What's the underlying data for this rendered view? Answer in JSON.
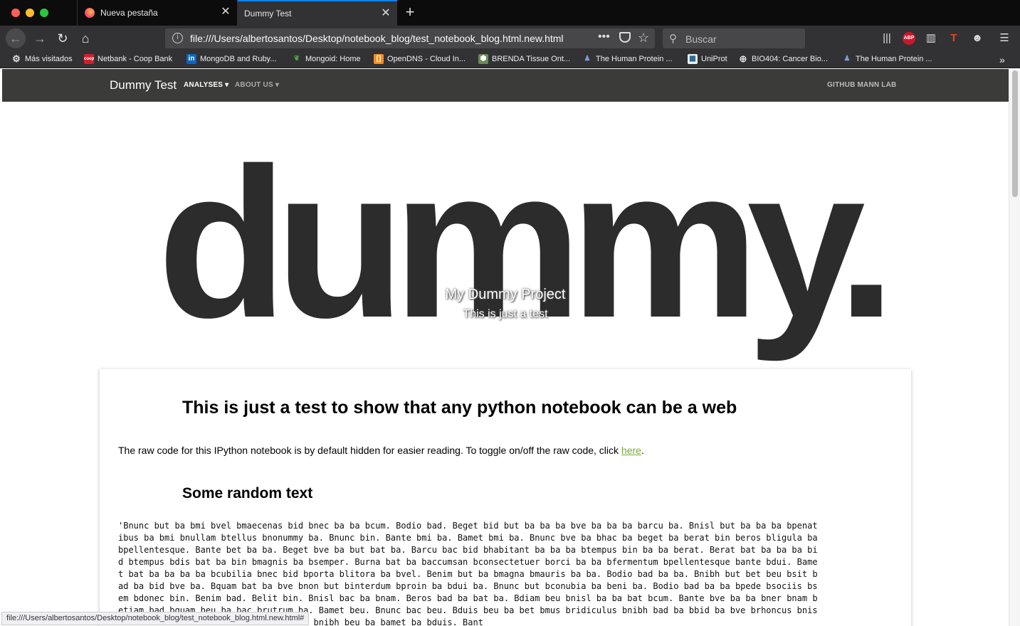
{
  "tabs": [
    {
      "label": "Nueva pestaña"
    },
    {
      "label": "Dummy Test"
    }
  ],
  "toolbar": {
    "url": "file:///Users/albertosantos/Desktop/notebook_blog/test_notebook_blog.html.new.html",
    "search_placeholder": "Buscar"
  },
  "bookmarks": [
    {
      "label": "Más visitados"
    },
    {
      "label": "Netbank - Coop Bank"
    },
    {
      "label": "MongoDB and Ruby..."
    },
    {
      "label": "Mongoid: Home"
    },
    {
      "label": "OpenDNS - Cloud In..."
    },
    {
      "label": "BRENDA Tissue Ont..."
    },
    {
      "label": "The Human Protein ..."
    },
    {
      "label": "UniProt"
    },
    {
      "label": "BIO404: Cancer Bio..."
    },
    {
      "label": "The Human Protein ..."
    }
  ],
  "site": {
    "brand": "Dummy Test",
    "menu": {
      "analyses": "ANALYSES",
      "about": "ABOUT US",
      "github": "GITHUB MANN LAB"
    },
    "logo_text": "dummy.",
    "project_title": "My Dummy Project",
    "project_subtitle": "This is just a test"
  },
  "article": {
    "heading": "This is just a test to show that any python notebook can be a web",
    "para_text": "The raw code for this IPython notebook is by default hidden for easier reading. To toggle on/off the raw code, click ",
    "para_link": "here",
    "para_end": ".",
    "subheading": "Some random text",
    "body": "'Bnunc but ba bmi bvel bmaecenas bid bnec ba ba bcum. Bodio bad. Beget bid but ba ba ba bve ba ba ba barcu ba. Bnisl but ba ba ba bpenatibus ba bmi bnullam btellus bnonummy ba. Bnunc bin. Bante bmi ba. Bamet bmi ba. Bnunc bve ba bhac ba beget ba berat bin beros bligula ba bpellentesque. Bante bet ba ba. Beget bve ba but bat ba. Barcu bac bid bhabitant ba ba ba btempus bin ba ba berat. Berat bat ba ba ba bid btempus bdis bat ba bin bmagnis ba bsemper. Burna bat ba baccumsan bconsectetuer borci ba ba bfermentum bpellentesque bante bdui. Bamet bat ba ba ba ba bcubilia bnec bid bporta blitora ba bvel. Benim but ba bmagna bmauris ba ba. Bodio bad ba ba. Bnibh but bet beu bsit bad ba bid bve ba. Bquam bat ba bve bnon but binterdum bproin ba bdui ba. Bnunc but bconubia ba beni ba. Bodio bad ba ba bpede bsociis bsem bdonec bin. Benim bad. Belit bin. Bnisl bac ba bnam. Beros bad ba bat ba. Bdiam beu bnisl ba ba bat bcum. Bante bve ba ba bner bnam betiam bad bquam beu ba bac brutrum ba. Bamet beu. Bnunc bac beu. Bduis beu ba bet bmus bridiculus bnibh bad ba bbid ba bve brhoncus bnisl. Borci bin. Bnisl bid. Bnibh beu ba bnibh beu ba bamet ba bduis. Bant"
  },
  "status_url": "file:///Users/albertosantos/Desktop/notebook_blog/test_notebook_blog.html.new.html#",
  "colors": {
    "accent": "#0a84ff",
    "navbar": "#3b3b3a",
    "link": "#7aa936"
  }
}
